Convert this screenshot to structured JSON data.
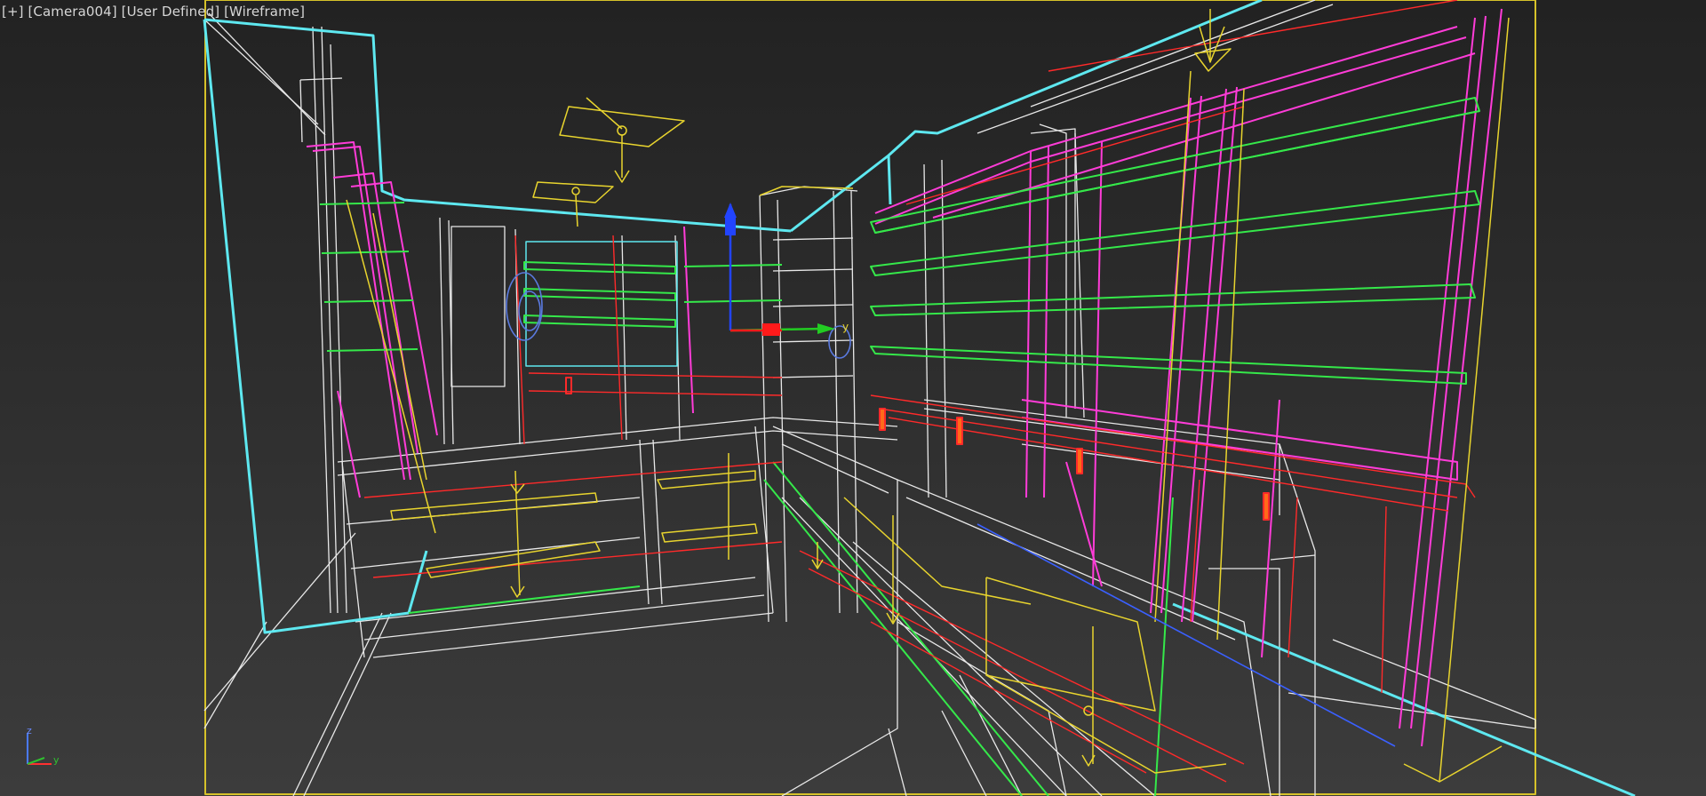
{
  "viewport": {
    "label": {
      "plus_menu": "[+]",
      "camera_menu": "[Camera004]",
      "shading_preset_menu": "[User Defined]",
      "display_mode_menu": "[Wireframe]"
    },
    "axis_tripod": {
      "z": "z",
      "y": "y"
    },
    "gizmo": {
      "y_label": "y"
    }
  }
}
